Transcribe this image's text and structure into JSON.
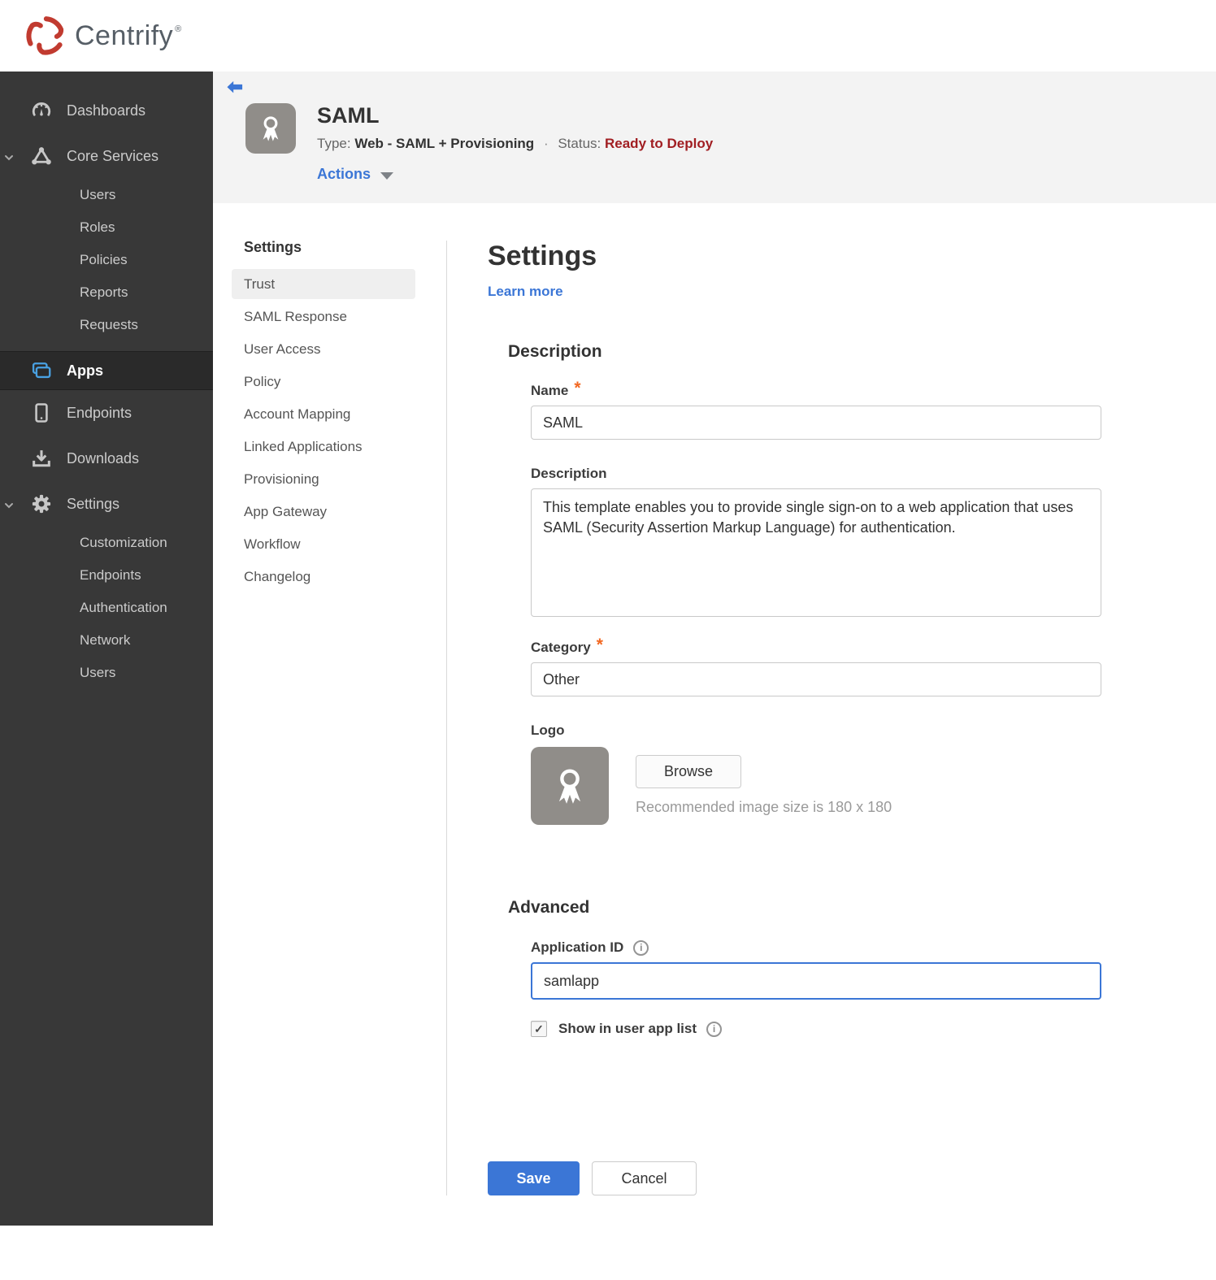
{
  "brand": {
    "name": "Centrify",
    "trademark": "®"
  },
  "sidebar": {
    "items": [
      {
        "label": "Dashboards",
        "icon": "gauge-icon",
        "type": "top"
      },
      {
        "label": "Core Services",
        "icon": "core-services-icon",
        "type": "top",
        "expanded": true
      },
      {
        "label": "Users",
        "type": "sub"
      },
      {
        "label": "Roles",
        "type": "sub"
      },
      {
        "label": "Policies",
        "type": "sub"
      },
      {
        "label": "Reports",
        "type": "sub"
      },
      {
        "label": "Requests",
        "type": "sub"
      },
      {
        "label": "Apps",
        "icon": "apps-icon",
        "type": "top",
        "active": true
      },
      {
        "label": "Endpoints",
        "icon": "phone-icon",
        "type": "top"
      },
      {
        "label": "Downloads",
        "icon": "download-icon",
        "type": "top"
      },
      {
        "label": "Settings",
        "icon": "gear-icon",
        "type": "top",
        "expanded": true
      },
      {
        "label": "Customization",
        "type": "sub"
      },
      {
        "label": "Endpoints",
        "type": "sub"
      },
      {
        "label": "Authentication",
        "type": "sub"
      },
      {
        "label": "Network",
        "type": "sub"
      },
      {
        "label": "Users",
        "type": "sub"
      }
    ]
  },
  "app_header": {
    "title": "SAML",
    "type_label": "Type:",
    "type_value": "Web - SAML + Provisioning",
    "separator": "·",
    "status_label": "Status:",
    "status_value": "Ready to Deploy",
    "actions_label": "Actions"
  },
  "subnav": {
    "header": "Settings",
    "active": "Trust",
    "items": [
      "Trust",
      "SAML Response",
      "User Access",
      "Policy",
      "Account Mapping",
      "Linked Applications",
      "Provisioning",
      "App Gateway",
      "Workflow",
      "Changelog"
    ]
  },
  "main": {
    "title": "Settings",
    "learn_more": "Learn more",
    "required_marker": "*",
    "description_section": {
      "heading": "Description",
      "name_label": "Name",
      "name_value": "SAML",
      "description_label": "Description",
      "description_value": "This template enables you to provide single sign-on to a web application that uses SAML (Security Assertion Markup Language) for authentication.",
      "category_label": "Category",
      "category_value": "Other",
      "logo_label": "Logo",
      "browse_label": "Browse",
      "logo_hint": "Recommended image size is 180 x 180"
    },
    "advanced_section": {
      "heading": "Advanced",
      "app_id_label": "Application ID",
      "app_id_value": "samlapp",
      "show_in_app_list_label": "Show in user app list",
      "checkbox_checked": true
    },
    "buttons": {
      "save": "Save",
      "cancel": "Cancel"
    }
  },
  "icons": {
    "info": "i",
    "check": "✓"
  },
  "colors": {
    "accent_blue": "#3b76d6",
    "apps_icon_blue": "#49a1e2",
    "status_red": "#a11e22",
    "required_orange": "#f26822",
    "sidebar_bg": "#383838",
    "header_band": "#f3f3f3",
    "brand_red": "#c13b30"
  }
}
